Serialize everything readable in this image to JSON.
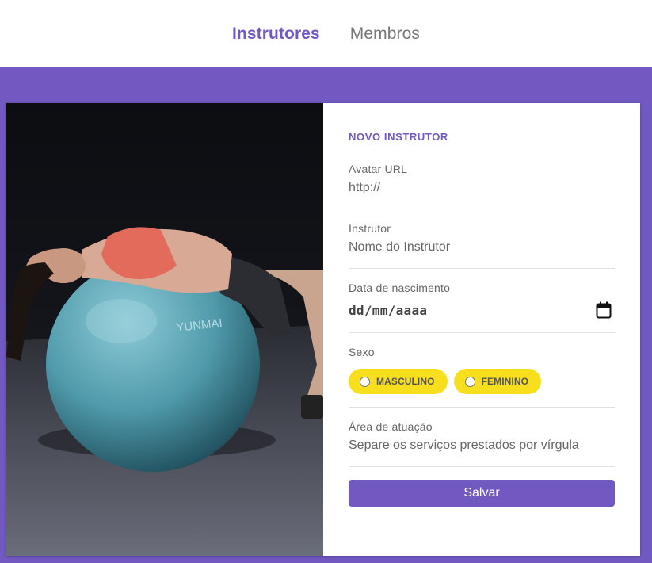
{
  "nav": {
    "instructors": "Instrutores",
    "members": "Membros"
  },
  "form": {
    "title": "NOVO INSTRUTOR",
    "avatar": {
      "label": "Avatar URL",
      "placeholder": "http://"
    },
    "name": {
      "label": "Instrutor",
      "placeholder": "Nome do Instrutor"
    },
    "birth": {
      "label": "Data de nascimento",
      "placeholder": "dd/mm/aaaa"
    },
    "gender": {
      "label": "Sexo",
      "options": [
        "MASCULINO",
        "FEMININO"
      ]
    },
    "services": {
      "label": "Área de atuação",
      "placeholder": "Separe os serviços prestados por vírgula"
    },
    "save_label": "Salvar"
  },
  "photo": {
    "ball_brand": "YUNMAI"
  },
  "colors": {
    "primary": "#7159c1",
    "pill": "#f7df1e"
  }
}
